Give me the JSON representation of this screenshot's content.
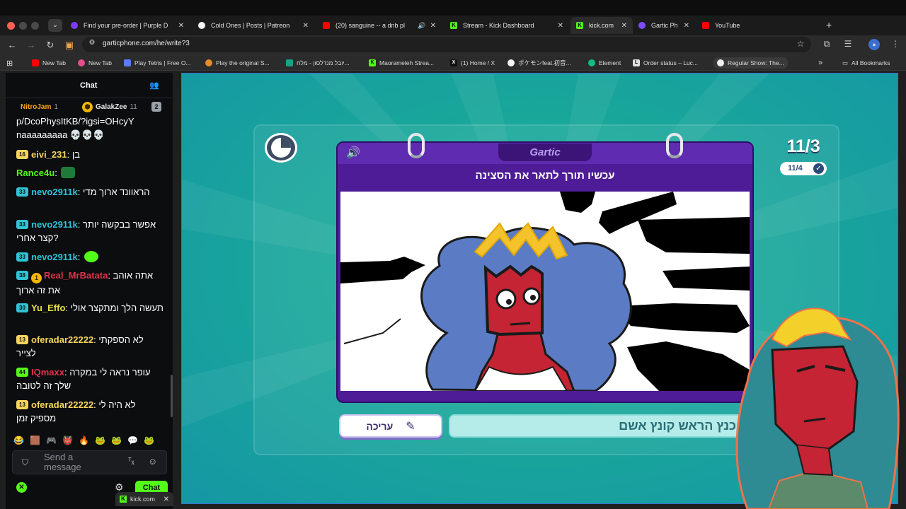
{
  "browser": {
    "tabs": [
      {
        "title": "Find your pre-order | Purple D",
        "favicon_color": "#7a3cff",
        "favicon": "",
        "active": false
      },
      {
        "title": "Cold Ones | Posts | Patreon",
        "favicon_color": "#f4f4f4",
        "favicon": "",
        "active": false
      },
      {
        "title": "(20) sanguine -- a dnb pl",
        "favicon_color": "#ff0000",
        "favicon": "",
        "active": false
      },
      {
        "title": "Stream - Kick Dashboard",
        "favicon_color": "#53fc18",
        "favicon": "K",
        "active": false
      },
      {
        "title": "kick.com",
        "favicon_color": "#53fc18",
        "favicon": "K",
        "active": true
      },
      {
        "title": "Gartic Ph",
        "favicon_color": "#7c4dff",
        "favicon": "",
        "active": false
      },
      {
        "title": "YouTube",
        "favicon_color": "#ff0000",
        "favicon": "",
        "active": false
      }
    ],
    "url": "garticphone.com/he/write?3",
    "bookmarks": [
      {
        "label": "New Tab",
        "color": "#ff0000",
        "favicon": ""
      },
      {
        "label": "New Tab",
        "color": "#e44d8e",
        "favicon": ""
      },
      {
        "label": "Play Tetris | Free O...",
        "color": "#5a7cff",
        "favicon": ""
      },
      {
        "label": "Play the original S...",
        "color": "#e98b2a",
        "favicon": ""
      },
      {
        "label": "יובל מנדלסון - מלח...",
        "color": "#1aa085",
        "favicon": ""
      },
      {
        "label": "Maorameleh Strea...",
        "color": "#53fc18",
        "favicon": "K"
      },
      {
        "label": "(1) Home / X",
        "color": "#111111",
        "favicon": "X"
      },
      {
        "label": "ポケモンfeat.初音...",
        "color": "#f8f8f8",
        "favicon": ""
      },
      {
        "label": "Element",
        "color": "#0dbd8b",
        "favicon": ""
      },
      {
        "label": "Order status – Luc...",
        "color": "#e0e0e0",
        "favicon": "L"
      },
      {
        "label": "Regular Show: The...",
        "color": "#f0f0f0",
        "favicon": ""
      }
    ],
    "all_bookmarks": "All Bookmarks",
    "popup_tab": "kick.com"
  },
  "chat": {
    "title": "Chat",
    "leaderboard": [
      {
        "name": "NitroJam",
        "count": "1",
        "color": "#f5a623"
      },
      {
        "name": "GalakZee",
        "count": "11",
        "color": "#e8e8e8"
      },
      {
        "name": "",
        "count": "2",
        "color": "#9aa0a6"
      }
    ],
    "messages": [
      {
        "badge": "",
        "badge_color": "",
        "coin": "",
        "user": "",
        "user_color": "#ffffff",
        "text": "p/DcoPhysItKB/?igsi=OHcyY\nnaaaaaaaaa 💀💀💀"
      },
      {
        "badge": "16",
        "badge_color": "#f6d55c",
        "coin": "",
        "user": "eivi_231",
        "user_color": "#f6d55c",
        "text": "בן"
      },
      {
        "badge": "",
        "badge_color": "",
        "coin": "",
        "user": "Rance4u",
        "user_color": "#53fc18",
        "text": "",
        "emote": "#1f7a3a"
      },
      {
        "badge": "33",
        "badge_color": "#2ec4d6",
        "coin": "",
        "user": "nevo2911k",
        "user_color": "#2ec4d6",
        "text": "הראוונד ארוך מדי"
      },
      {
        "badge": "33",
        "badge_color": "#2ec4d6",
        "coin": "",
        "user": "nevo2911k",
        "user_color": "#2ec4d6",
        "text": "אפשר בבקשה יותר קצר אחרי?"
      },
      {
        "badge": "33",
        "badge_color": "#2ec4d6",
        "coin": "",
        "user": "nevo2911k",
        "user_color": "#2ec4d6",
        "text": "",
        "emote": "#53fc18"
      },
      {
        "badge": "38",
        "badge_color": "#2ec4d6",
        "coin": "1",
        "user": "Real_MrBatata",
        "user_color": "#e0334a",
        "text": "אתה אוהב את זה ארוך"
      },
      {
        "badge": "30",
        "badge_color": "#2ec4d6",
        "coin": "",
        "user": "Yu_Effo",
        "user_color": "#e8e14a",
        "text": "תעשה הלך ומתקצר אולי"
      },
      {
        "badge": "13",
        "badge_color": "#f6d55c",
        "coin": "",
        "user": "oferadar22222",
        "user_color": "#f6d55c",
        "text": "לא הספקתי לצייר"
      },
      {
        "badge": "44",
        "badge_color": "#53fc18",
        "coin": "",
        "user": "IQmaxx",
        "user_color": "#e0334a",
        "text": "עופר נראה לי במקרה שלך זה לטובה"
      },
      {
        "badge": "13",
        "badge_color": "#f6d55c",
        "coin": "",
        "user": "oferadar22222",
        "user_color": "#f6d55c",
        "text": "לא היה לי מספיק זמן"
      }
    ],
    "emote_bar": [
      "😂",
      "🟫",
      "🎮",
      "👹",
      "🔥",
      "🐸",
      "🐸",
      "💬",
      "🐸"
    ],
    "input_placeholder": "Send a message",
    "send_label": "Chat"
  },
  "game": {
    "round_main": "11/3",
    "round_sub": "11/4",
    "logo": "Gartic",
    "prompt": "עכשיו תורך לתאר את הסצינה",
    "edit_label": "עריכה",
    "answer_text": "כנץ הראש קונץ אשם"
  }
}
